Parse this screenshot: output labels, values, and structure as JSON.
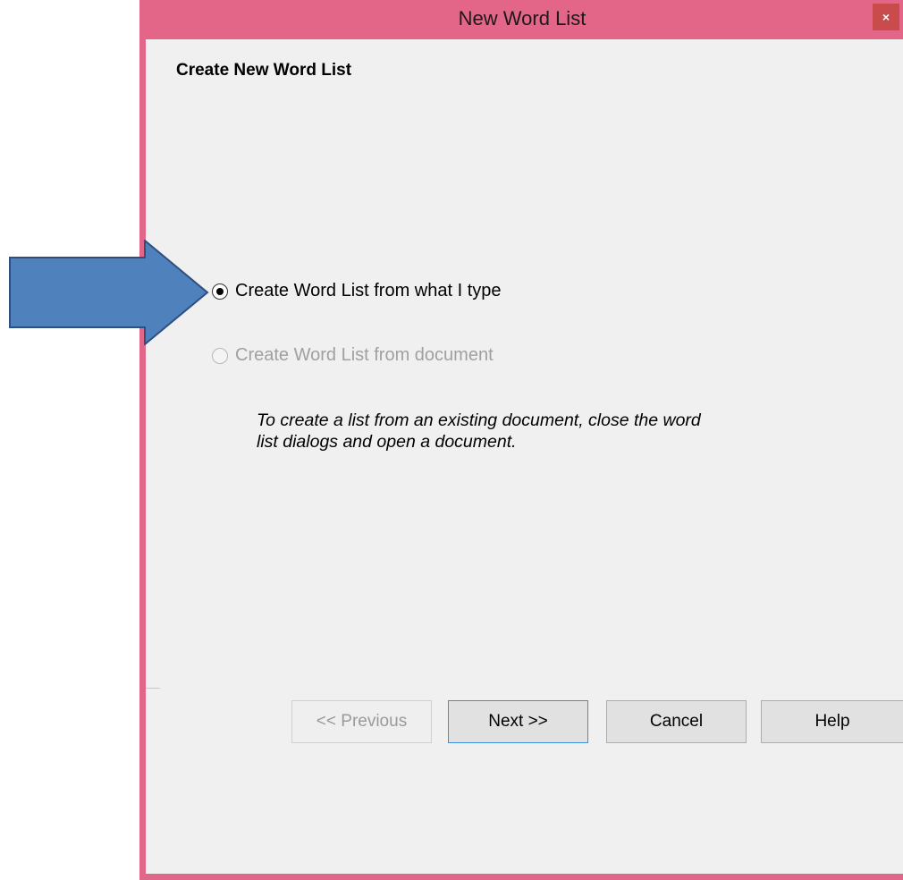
{
  "window": {
    "title": "New Word List",
    "close_glyph": "×"
  },
  "page": {
    "heading": "Create New Word List"
  },
  "options": [
    {
      "label": "Create Word List from what I type",
      "selected": true,
      "enabled": true
    },
    {
      "label": "Create Word List from document",
      "selected": false,
      "enabled": false
    }
  ],
  "note": "To create a list from an existing document, close the word list dialogs and open a document.",
  "buttons": {
    "previous": "<< Previous",
    "next": "Next >>",
    "cancel": "Cancel",
    "help": "Help"
  },
  "annotation": {
    "icon": "arrow-right-icon",
    "color": "#4f81bd"
  }
}
